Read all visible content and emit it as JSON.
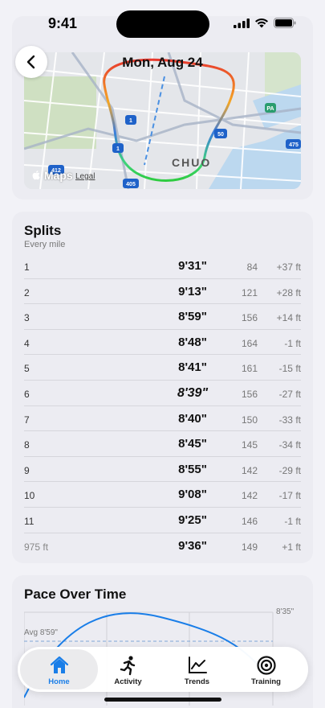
{
  "status": {
    "time": "9:41"
  },
  "map": {
    "title": "Mon, Aug 24",
    "district": "CHUO",
    "maps_label": "Maps",
    "legal_label": "Legal",
    "route_shields": [
      "1",
      "1",
      "50",
      "412",
      "405",
      "475",
      "PA"
    ]
  },
  "splits": {
    "title": "Splits",
    "subtitle": "Every mile",
    "rows": [
      {
        "label": "1",
        "pace": "9'31\"",
        "hr": "84",
        "elev": "+37 ft",
        "bar": 0.3
      },
      {
        "label": "2",
        "pace": "9'13\"",
        "hr": "121",
        "elev": "+28 ft",
        "bar": 0.52
      },
      {
        "label": "3",
        "pace": "8'59\"",
        "hr": "156",
        "elev": "+14 ft",
        "bar": 0.68
      },
      {
        "label": "4",
        "pace": "8'48\"",
        "hr": "164",
        "elev": "-1 ft",
        "bar": 0.8
      },
      {
        "label": "5",
        "pace": "8'41\"",
        "hr": "161",
        "elev": "-15 ft",
        "bar": 0.9
      },
      {
        "label": "6",
        "pace": "8'39\"",
        "hr": "156",
        "elev": "-27 ft",
        "bar": 0.93,
        "best": true
      },
      {
        "label": "7",
        "pace": "8'40\"",
        "hr": "150",
        "elev": "-33 ft",
        "bar": 0.91
      },
      {
        "label": "8",
        "pace": "8'45\"",
        "hr": "145",
        "elev": "-34 ft",
        "bar": 0.84
      },
      {
        "label": "9",
        "pace": "8'55\"",
        "hr": "142",
        "elev": "-29 ft",
        "bar": 0.72
      },
      {
        "label": "10",
        "pace": "9'08\"",
        "hr": "142",
        "elev": "-17 ft",
        "bar": 0.57
      },
      {
        "label": "11",
        "pace": "9'25\"",
        "hr": "146",
        "elev": "-1 ft",
        "bar": 0.36
      },
      {
        "label": "975 ft",
        "pace": "9'36\"",
        "hr": "149",
        "elev": "+1 ft",
        "bar": 0.22
      }
    ]
  },
  "pace_over_time": {
    "title": "Pace Over Time",
    "avg_label": "Avg 8'59\"",
    "top_label": "8'35\""
  },
  "tabs": [
    {
      "label": "Home",
      "icon": "house-icon",
      "active": true
    },
    {
      "label": "Activity",
      "icon": "runner-icon",
      "active": false
    },
    {
      "label": "Trends",
      "icon": "chart-icon",
      "active": false
    },
    {
      "label": "Training",
      "icon": "target-icon",
      "active": false
    }
  ],
  "colors": {
    "accent": "#1a7ee8",
    "bar": "#6eb8f6",
    "bar_best": "#1482e8",
    "card": "#ececf2"
  }
}
